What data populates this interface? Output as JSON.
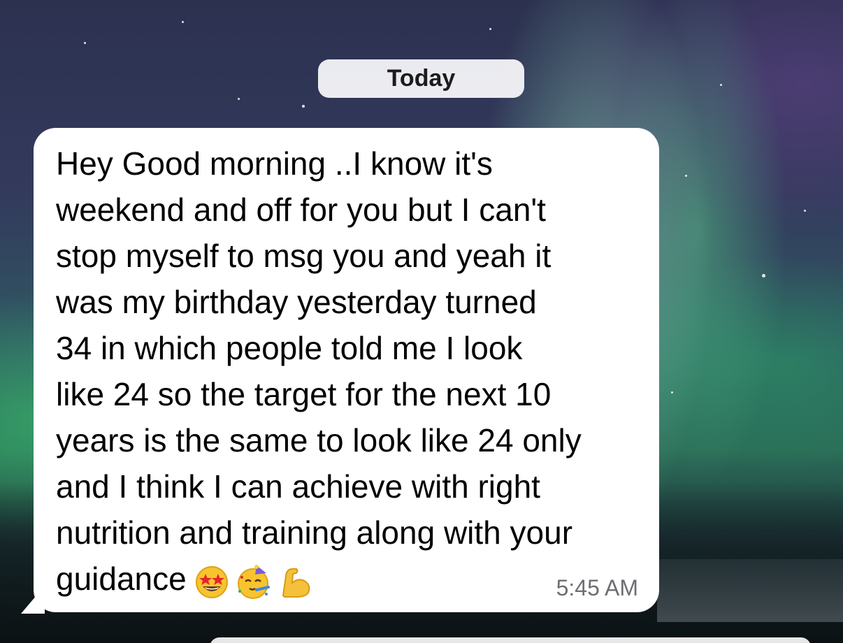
{
  "chat": {
    "date_separator": "Today",
    "message": {
      "lines": [
        "Hey Good morning ..I know it's",
        "weekend and off for you but I can't",
        "stop myself to msg you and yeah it",
        "was my birthday yesterday turned",
        "34 in which people told me I look",
        "like 24 so the target for the next 10",
        "years is the same to look like 24 only",
        "and I think I can achieve with right",
        "nutrition and training along with your",
        "guidance"
      ],
      "emojis": [
        "star-struck-emoji",
        "partying-face-emoji",
        "flexed-biceps-emoji"
      ],
      "time": "5:45 AM"
    }
  },
  "colors": {
    "bubble": "#ffffff",
    "text": "#000000",
    "timestamp": "#6e6e73",
    "date_pill": "#f2f2f7"
  }
}
